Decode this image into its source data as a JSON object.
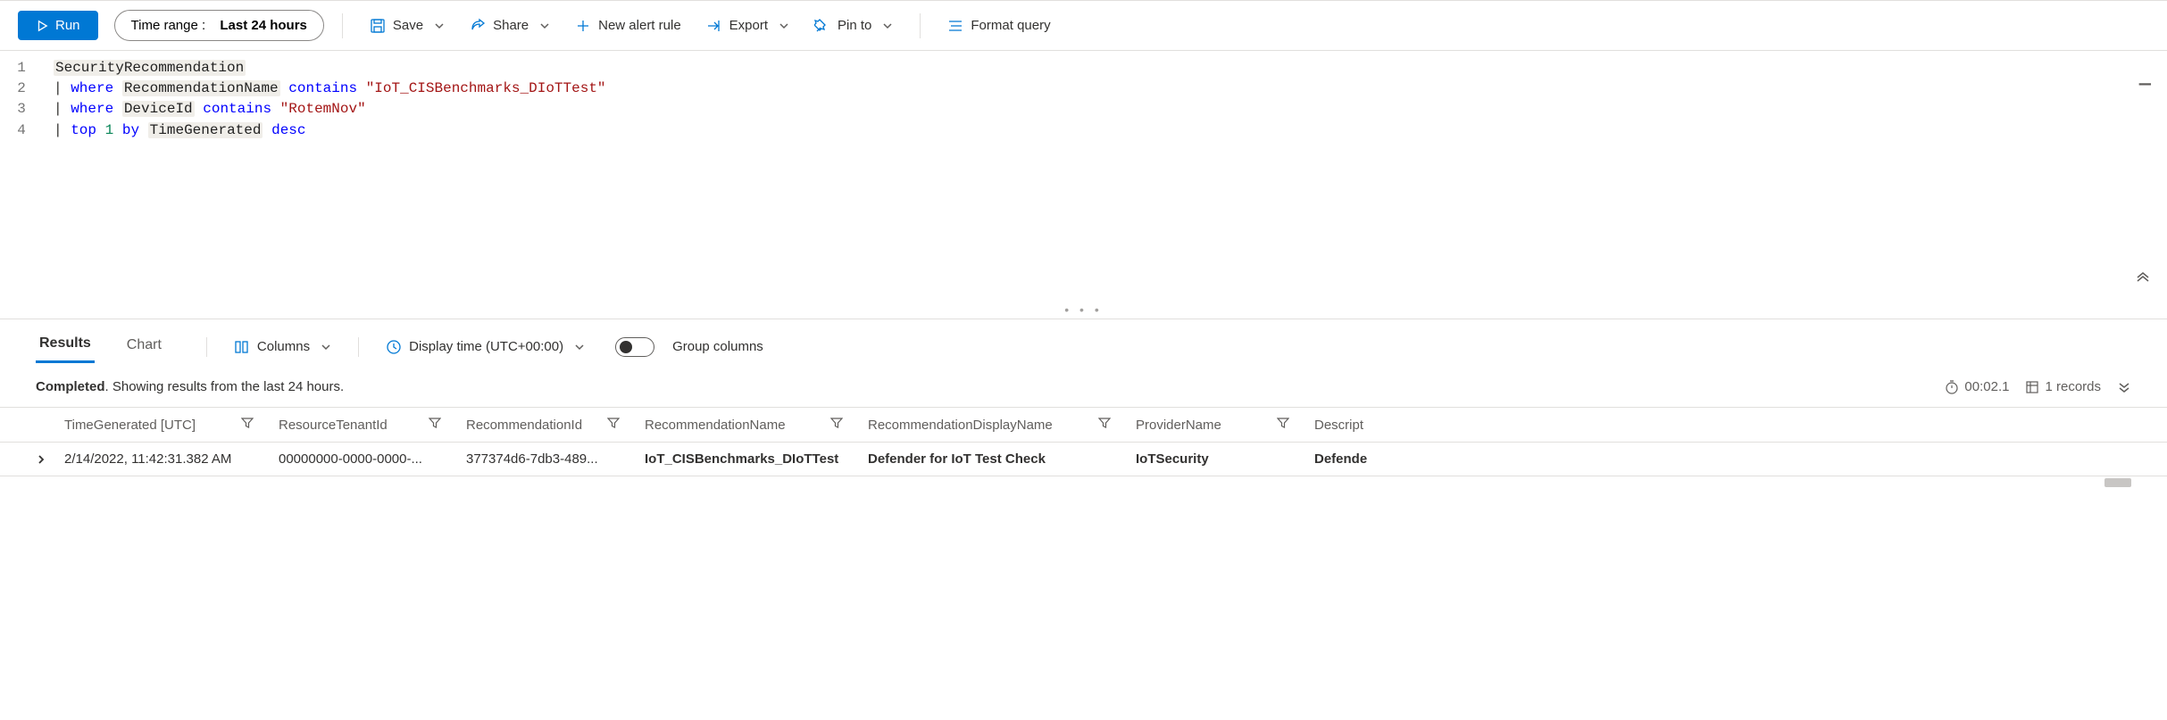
{
  "toolbar": {
    "run_label": "Run",
    "time_range_label": "Time range :",
    "time_range_value": "Last 24 hours",
    "save_label": "Save",
    "share_label": "Share",
    "new_alert_label": "New alert rule",
    "export_label": "Export",
    "pin_label": "Pin to",
    "format_label": "Format query"
  },
  "editor": {
    "lines": [
      {
        "num": "1",
        "tokens": [
          {
            "t": "ident",
            "v": "SecurityRecommendation"
          }
        ]
      },
      {
        "num": "2",
        "tokens": [
          {
            "t": "pipe",
            "v": "| "
          },
          {
            "t": "keyword",
            "v": "where"
          },
          {
            "t": "plain",
            "v": " "
          },
          {
            "t": "ident",
            "v": "RecommendationName"
          },
          {
            "t": "plain",
            "v": " "
          },
          {
            "t": "func",
            "v": "contains"
          },
          {
            "t": "plain",
            "v": " "
          },
          {
            "t": "string",
            "v": "\"IoT_CISBenchmarks_DIoTTest\""
          }
        ]
      },
      {
        "num": "3",
        "tokens": [
          {
            "t": "pipe",
            "v": "| "
          },
          {
            "t": "keyword",
            "v": "where"
          },
          {
            "t": "plain",
            "v": " "
          },
          {
            "t": "ident",
            "v": "DeviceId"
          },
          {
            "t": "plain",
            "v": " "
          },
          {
            "t": "func",
            "v": "contains"
          },
          {
            "t": "plain",
            "v": " "
          },
          {
            "t": "string",
            "v": "\"RotemNov\""
          }
        ]
      },
      {
        "num": "4",
        "tokens": [
          {
            "t": "pipe",
            "v": "| "
          },
          {
            "t": "keyword",
            "v": "top"
          },
          {
            "t": "plain",
            "v": " "
          },
          {
            "t": "number",
            "v": "1"
          },
          {
            "t": "plain",
            "v": " "
          },
          {
            "t": "keyword",
            "v": "by"
          },
          {
            "t": "plain",
            "v": " "
          },
          {
            "t": "ident",
            "v": "TimeGenerated"
          },
          {
            "t": "plain",
            "v": " "
          },
          {
            "t": "keyword",
            "v": "desc"
          }
        ]
      }
    ]
  },
  "results_bar": {
    "tab_results": "Results",
    "tab_chart": "Chart",
    "columns_label": "Columns",
    "display_time_label": "Display time (UTC+00:00)",
    "group_columns_label": "Group columns"
  },
  "status": {
    "completed": "Completed",
    "period_text": ". Showing results from the last 24 hours.",
    "elapsed": "00:02.1",
    "records": "1 records"
  },
  "table": {
    "headers": {
      "time": "TimeGenerated [UTC]",
      "tenant": "ResourceTenantId",
      "recid": "RecommendationId",
      "recname": "RecommendationName",
      "dispname": "RecommendationDisplayName",
      "provider": "ProviderName",
      "desc": "Descript"
    },
    "row": {
      "time": "2/14/2022, 11:42:31.382 AM",
      "tenant": "00000000-0000-0000-...",
      "recid": "377374d6-7db3-489...",
      "recname": "IoT_CISBenchmarks_DIoTTest",
      "dispname": "Defender for IoT Test Check",
      "provider": "IoTSecurity",
      "desc": "Defende"
    }
  }
}
